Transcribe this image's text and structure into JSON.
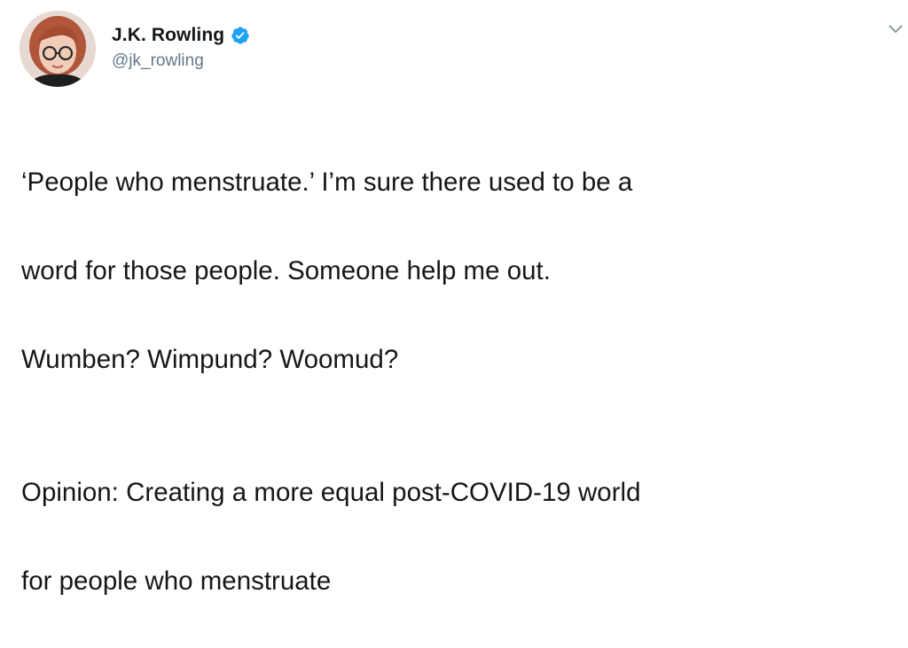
{
  "tweet": {
    "author": {
      "display_name": "J.K. Rowling",
      "handle": "@jk_rowling",
      "verified": true,
      "avatar_icon": "profile-photo",
      "verified_color": "#1da1f2"
    },
    "menu_icon": "chevron-down-icon",
    "text_lines": [
      "‘People who menstruate.’ I’m sure there used to be a",
      "word for those people. Someone help me out.",
      "Wumben? Wimpund? Woomud?"
    ],
    "quoted_headline_lines": [
      "Opinion: Creating a more equal post-COVID-19 world",
      "for people who menstruate"
    ]
  }
}
